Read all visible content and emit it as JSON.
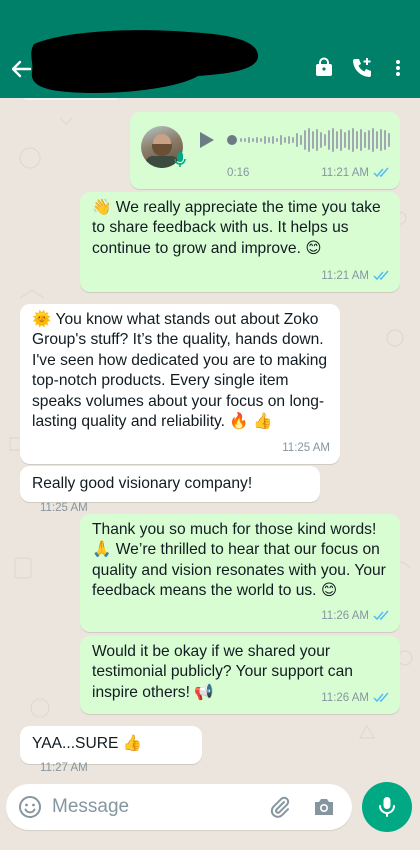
{
  "header": {
    "contact_name_redacted": true,
    "icons": [
      "back-arrow-icon",
      "business-bag-icon",
      "add-call-icon",
      "more-vert-icon"
    ],
    "color": "#008069"
  },
  "messages": [
    {
      "id": "voice",
      "direction": "outgoing",
      "type": "voice",
      "duration": "0:16",
      "time": "11:21 AM",
      "read": true
    },
    {
      "id": "m1",
      "direction": "outgoing",
      "emoji": "👋",
      "text": "We really appreciate the time you take to share feedback with us. It helps us continue to grow and improve. 😊",
      "time": "11:21 AM",
      "read": true
    },
    {
      "id": "m2",
      "direction": "incoming",
      "emoji": "🌞",
      "text": "You know what stands out about Zoko Group's stuff? It’s the quality, hands down. I've seen how dedicated you are to making top-notch products. Every single item speaks volumes about your focus on long-lasting quality and reliability. 🔥 👍",
      "time": "11:25 AM"
    },
    {
      "id": "m3",
      "direction": "incoming",
      "text": "Really good visionary company!",
      "time": "11:25 AM"
    },
    {
      "id": "m4",
      "direction": "outgoing",
      "text": "Thank you so much for those kind words! 🙏 We’re thrilled to hear that our focus on quality and vision resonates with you. Your feedback means the world to us. 😊",
      "time": "11:26 AM",
      "read": true
    },
    {
      "id": "m5",
      "direction": "outgoing",
      "text": "Would it be okay if we shared your testimonial publicly? Your support can inspire others! 📢",
      "time": "11:26 AM",
      "read": true
    },
    {
      "id": "m6",
      "direction": "incoming",
      "text": "YAA...SURE 👍",
      "time": "11:27 AM"
    }
  ],
  "composer": {
    "placeholder": "Message",
    "value": ""
  },
  "colors": {
    "outgoing": "#d9fdd3",
    "incoming": "#ffffff",
    "read_ticks": "#53bdeb",
    "accent": "#00a884",
    "background": "#ece5dd"
  }
}
